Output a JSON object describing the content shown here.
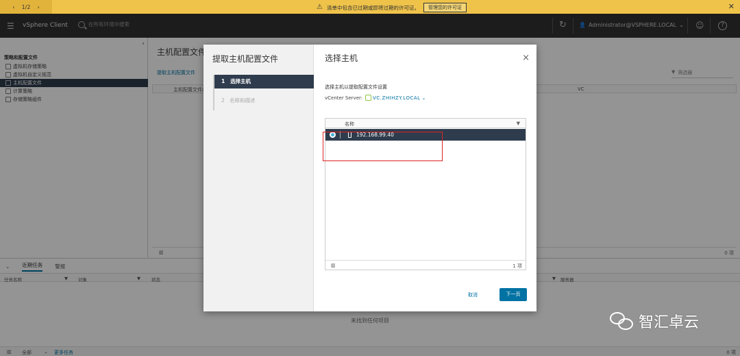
{
  "notice": {
    "pager": "1/2",
    "message": "清单中包含已过期或即将过期的许可证。",
    "manage_button": "管理您的许可证"
  },
  "header": {
    "brand": "vSphere Client",
    "search_placeholder": "在所有环境中搜索",
    "user": "Administrator@VSPHERE.LOCAL"
  },
  "leftnav": {
    "heading": "策略和配置文件",
    "items": [
      {
        "label": "虚拟机存储策略"
      },
      {
        "label": "虚拟机自定义规范"
      },
      {
        "label": "主机配置文件"
      },
      {
        "label": "计算策略"
      },
      {
        "label": "存储策略组件"
      }
    ]
  },
  "main": {
    "title": "主机配置文件",
    "action_link": "提取主机配置文件",
    "filter_placeholder": "筛选器",
    "col_name": "主机配置文件名",
    "col_vc": "VC",
    "count": "0 项"
  },
  "bottom": {
    "tabs": [
      "近期任务",
      "警报"
    ],
    "columns": {
      "task": "任务名称",
      "target": "对象",
      "status": "状态",
      "server": "服务器"
    },
    "empty": "未找到任何项目",
    "footer_filter": "全部",
    "more_tasks": "更多任务",
    "count": "0 项"
  },
  "modal": {
    "wizard_title": "提取主机配置文件",
    "steps": [
      {
        "num": "1",
        "label": "选择主机"
      },
      {
        "num": "2",
        "label": "名称和描述"
      }
    ],
    "pane_title": "选择主机",
    "description": "选择主机以提取配置文件设置",
    "vcenter_label": "vCenter Server:",
    "vcenter_value": "VC.ZHIHZY.LOCAL",
    "grid": {
      "col_name": "名称",
      "rows": [
        {
          "ip": "192.168.99.40"
        }
      ],
      "count": "1 项"
    },
    "cancel": "取消",
    "next": "下一页"
  },
  "watermark": "智汇卓云"
}
